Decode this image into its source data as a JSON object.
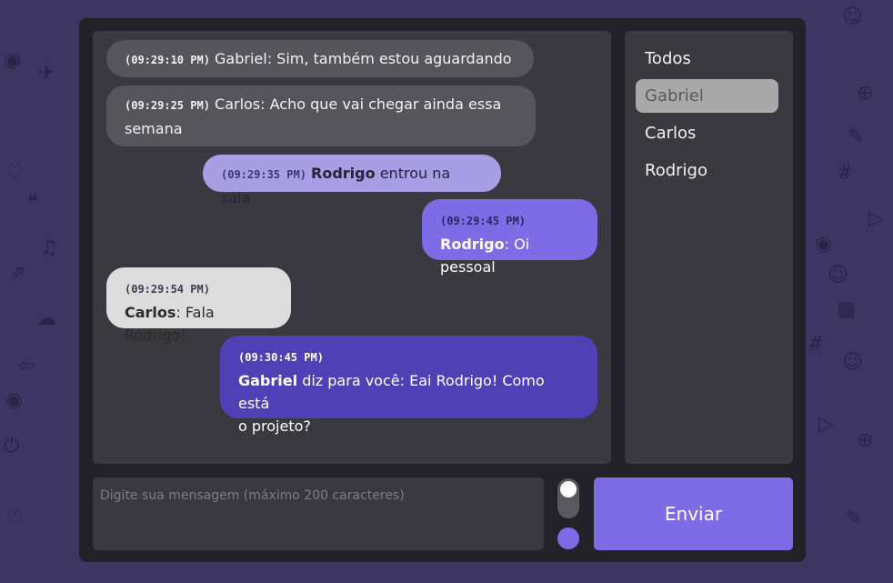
{
  "theme": {
    "background": "#3d3663",
    "panel": "#3a393f",
    "accent": "#7e6be6",
    "accent_dark": "#5040b6",
    "accent_light": "#a89ee4"
  },
  "messages": [
    {
      "time": "(09:29:10 PM)",
      "text": "Gabriel: Sim, também estou aguardando"
    },
    {
      "time": "(09:29:25 PM)",
      "text_line1": "Carlos: Acho que vai chegar ainda essa",
      "text_line2": "semana"
    },
    {
      "time": "(09:29:35 PM)",
      "user": "Rodrigo",
      "text": "entrou na sala"
    },
    {
      "time": "(09:29:45 PM)",
      "user": "Rodrigo",
      "text": ": Oi pessoal"
    },
    {
      "time": "(09:29:54 PM)",
      "user": "Carlos",
      "text": ": Fala Rodrigo!"
    },
    {
      "time": "(09:30:45 PM)",
      "user": "Gabriel",
      "text_line1": "diz para você: Eai Rodrigo! Como está",
      "text_line2": "o projeto?"
    }
  ],
  "users": [
    {
      "label": "Todos"
    },
    {
      "label": "Gabriel",
      "selected": true
    },
    {
      "label": "Carlos"
    },
    {
      "label": "Rodrigo"
    }
  ],
  "composer": {
    "placeholder": "Digite sua mensagem (máximo 200 caracteres)",
    "send_label": "Enviar"
  }
}
